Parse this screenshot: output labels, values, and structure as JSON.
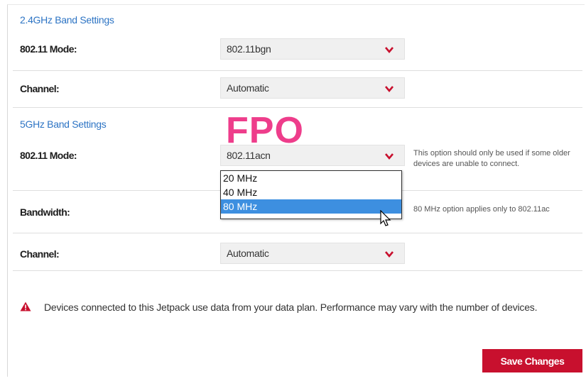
{
  "band24": {
    "title": "2.4GHz Band Settings",
    "mode_label": "802.11 Mode:",
    "mode_value": "802.11bgn",
    "channel_label": "Channel:",
    "channel_value": "Automatic"
  },
  "band5": {
    "title": "5GHz Band Settings",
    "mode_label": "802.11 Mode:",
    "mode_value": "802.11acn",
    "mode_help": "This option should only be used if some older devices are unable to connect.",
    "bandwidth_label": "Bandwidth:",
    "bandwidth_help": "80 MHz option applies only to 802.11ac",
    "bandwidth_options": [
      "20 MHz",
      "40 MHz",
      "80 MHz"
    ],
    "bandwidth_selected": "80 MHz",
    "channel_label": "Channel:",
    "channel_value": "Automatic"
  },
  "overlay": {
    "fpo": "FPO"
  },
  "notice": {
    "text": "Devices connected to this Jetpack use data from your data plan. Performance may vary with the number of devices."
  },
  "actions": {
    "save_label": "Save Changes"
  },
  "colors": {
    "accent_blue": "#2d74c4",
    "brand_red": "#c8102e",
    "selection_blue": "#3d8fe0",
    "fpo_pink": "#ee3d8b"
  },
  "icons": {
    "chevron": "chevron-down-icon",
    "warning": "warning-icon",
    "cursor": "cursor-icon"
  }
}
